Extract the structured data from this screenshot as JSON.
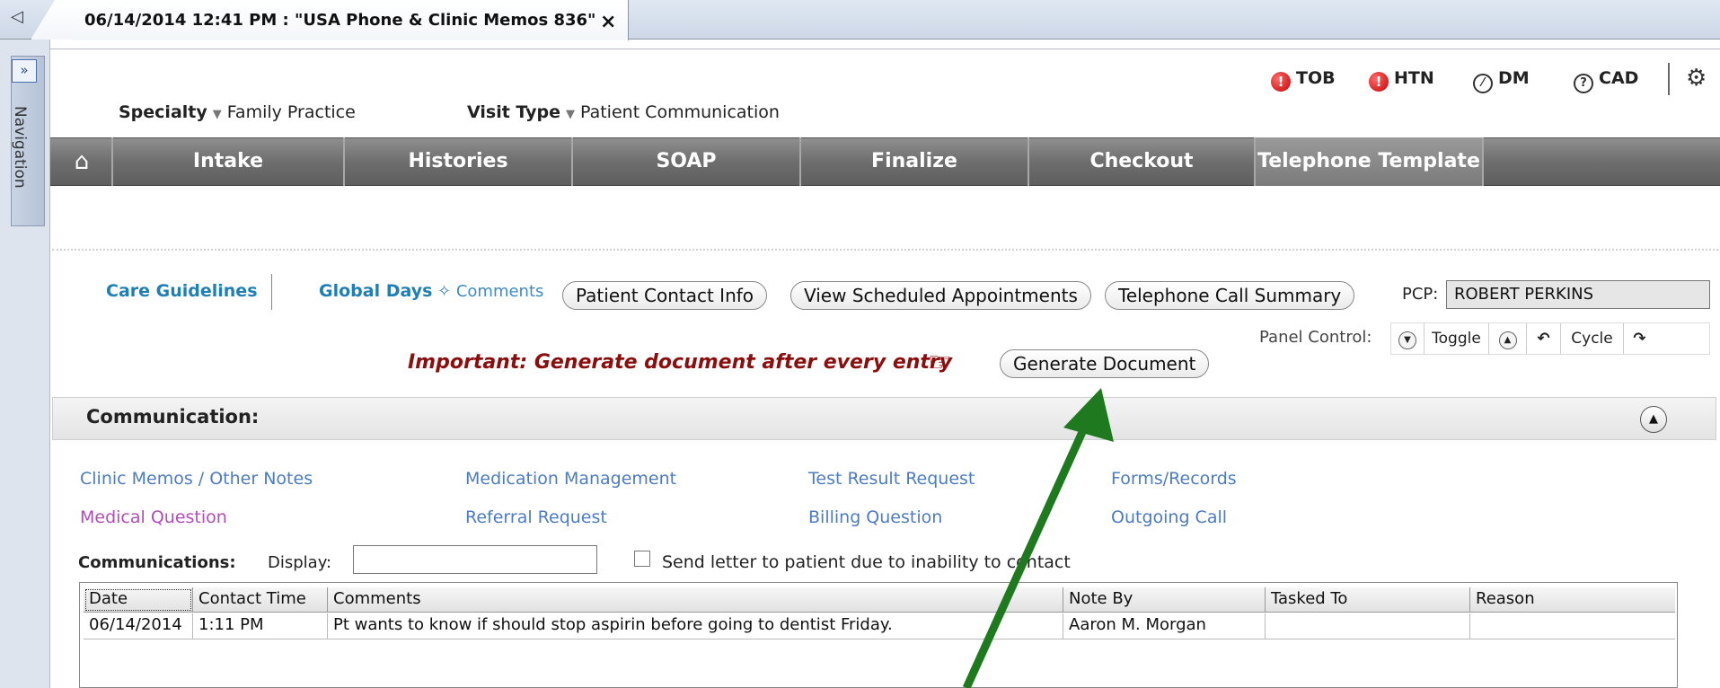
{
  "tab": {
    "back_icon": "back-arrow-icon",
    "title": "06/14/2014 12:41 PM : \"USA Phone & Clinic Memos 836\"",
    "close_glyph": "×"
  },
  "nav_rail": {
    "expand_glyph": "»",
    "label": "Navigation"
  },
  "indicators": [
    {
      "label": "TOB",
      "icon": "alert-red-icon"
    },
    {
      "label": "HTN",
      "icon": "alert-red-icon"
    },
    {
      "label": "DM",
      "icon": "none-symbol-icon"
    },
    {
      "label": "CAD",
      "icon": "question-icon"
    }
  ],
  "meta": {
    "specialty_key": "Specialty",
    "specialty_val": "Family Practice",
    "visit_key": "Visit Type",
    "visit_val": "Patient Communication"
  },
  "navbar": {
    "home_icon": "home-icon",
    "tabs": [
      "Intake",
      "Histories",
      "SOAP",
      "Finalize",
      "Checkout",
      "Telephone Template"
    ]
  },
  "links": {
    "care_guidelines": "Care Guidelines",
    "global_days": "Global Days",
    "comments": "Comments"
  },
  "buttons": {
    "patient_contact": "Patient Contact Info",
    "view_appointments": "View Scheduled Appointments",
    "call_summary": "Telephone Call Summary",
    "generate_document": "Generate Document"
  },
  "pcp": {
    "label": "PCP:",
    "value": "ROBERT PERKINS"
  },
  "panel_control": {
    "label": "Panel Control:",
    "toggle": "Toggle",
    "cycle": "Cycle"
  },
  "important": "Important:  Generate document after every entry",
  "communication": {
    "title": "Communication:",
    "categories": {
      "c1": "Clinic Memos / Other Notes",
      "c2": "Medication Management",
      "c3": "Test Result Request",
      "c4": "Forms/Records",
      "c5": "Medical Question",
      "c6": "Referral Request",
      "c7": "Billing Question",
      "c8": "Outgoing Call"
    },
    "list_label": "Communications:",
    "display_label": "Display:",
    "display_value": "",
    "checkbox_label": "Send letter to patient due to inability to contact"
  },
  "grid": {
    "headers": [
      "Date",
      "Contact Time",
      "Comments",
      "Note By",
      "Tasked To",
      "Reason"
    ],
    "rows": [
      [
        "06/14/2014",
        "1:11 PM",
        "Pt wants to know if should stop aspirin before going to dentist Friday.",
        "Aaron M. Morgan",
        "",
        ""
      ]
    ]
  },
  "colors": {
    "annotation_arrow": "#1f7a1f",
    "important_text": "#8b0e0e",
    "nav_bar": "#6e6e6e",
    "link_blue": "#4d7cc0",
    "link_purple": "#b04eb9"
  }
}
